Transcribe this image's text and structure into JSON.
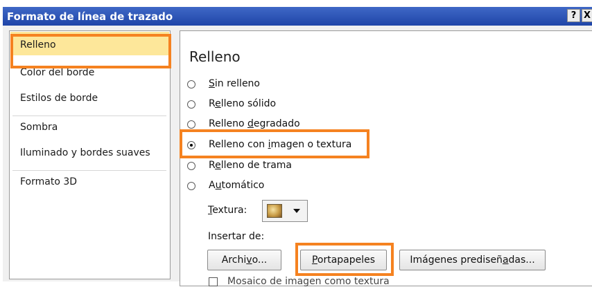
{
  "window": {
    "title": "Formato de línea de trazado",
    "help_label": "?",
    "close_label": "X"
  },
  "sidebar": {
    "items": [
      {
        "label": "Relleno",
        "selected": true
      },
      {
        "label": "Color del borde"
      },
      {
        "label": "Estilos de borde"
      },
      {
        "label": "Sombra"
      },
      {
        "label": "Iluminado y bordes suaves"
      },
      {
        "label": "Formato 3D"
      }
    ]
  },
  "panel": {
    "heading": "Relleno",
    "fill_options": [
      {
        "pre": "",
        "u": "S",
        "post": "in relleno",
        "checked": false
      },
      {
        "pre": "R",
        "u": "e",
        "post": "lleno sólido",
        "checked": false
      },
      {
        "pre": "Relleno ",
        "u": "d",
        "post": "egradado",
        "checked": false
      },
      {
        "pre": "Relleno con ",
        "u": "i",
        "post": "magen o textura",
        "checked": true
      },
      {
        "pre": "R",
        "u": "e",
        "post": "lleno de trama",
        "checked": false
      },
      {
        "pre": "A",
        "u": "u",
        "post": "tomático",
        "checked": false
      }
    ],
    "texture_label_u": "T",
    "texture_label_rest": "extura:",
    "texture_icon": "texture-swatch-icon",
    "insert_from_label": "Insertar de:",
    "buttons": {
      "file": {
        "pre": "Archi",
        "u": "v",
        "post": "o..."
      },
      "clipboard": {
        "pre": "",
        "u": "P",
        "post": "ortapapeles"
      },
      "clipart": {
        "pre": "Imágenes prediseñ",
        "u": "a",
        "post": "das..."
      }
    },
    "tile_checkbox_label": "Mosaico de imagen como textura",
    "tile_checked": false
  },
  "annotation": {
    "highlight_color": "#f58220"
  }
}
